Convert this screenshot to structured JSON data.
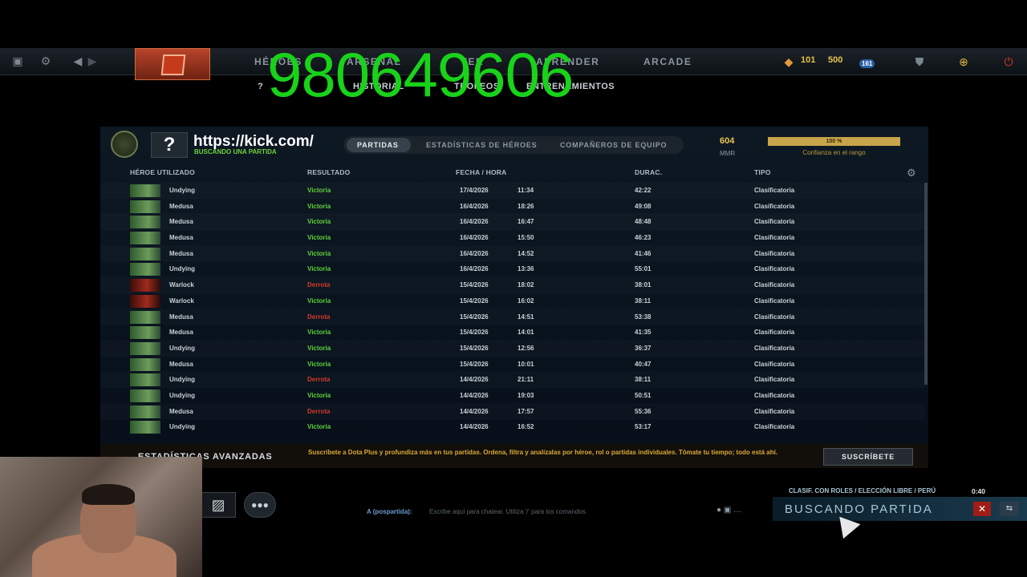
{
  "topbar": {
    "icons": [
      "screenshot-icon",
      "gear-icon",
      "back-icon",
      "forward-icon"
    ],
    "nav": [
      "HÉROES",
      "ARSENAL",
      "VER",
      "APRENDER",
      "ARCADE"
    ],
    "shards": "101",
    "tokens": "500",
    "level": "161"
  },
  "subnav": {
    "help": "?",
    "history": "HISTORIAL",
    "trophies": "TROFEOS",
    "training": "ENTRENAMIENTOS"
  },
  "overlay": {
    "phone": "980649606"
  },
  "profile": {
    "placeholder": "?",
    "name": "https://kick.com/",
    "status": "BUSCANDO UNA PARTIDA",
    "tabs": [
      "PARTIDAS",
      "ESTADÍSTICAS DE HÉROES",
      "COMPAÑEROS DE EQUIPO"
    ],
    "mmr_value": "604",
    "mmr_label": "MMR",
    "confidence_value": "100 %",
    "confidence_pct": 100,
    "confidence_label": "Confianza en el rango"
  },
  "table": {
    "headers": [
      "HÉROE UTILIZADO",
      "RESULTADO",
      "FECHA / HORA",
      "DURAC.",
      "TIPO"
    ],
    "rows": [
      {
        "hero": "Undying",
        "result": "Victoria",
        "date": "17/4/2026",
        "time": "11:34",
        "duration": "42:22",
        "type": "Clasificatoria",
        "win": true,
        "portrait": "green"
      },
      {
        "hero": "Medusa",
        "result": "Victoria",
        "date": "16/4/2026",
        "time": "18:26",
        "duration": "49:08",
        "type": "Clasificatoria",
        "win": true,
        "portrait": "green"
      },
      {
        "hero": "Medusa",
        "result": "Victoria",
        "date": "16/4/2026",
        "time": "16:47",
        "duration": "48:48",
        "type": "Clasificatoria",
        "win": true,
        "portrait": "green"
      },
      {
        "hero": "Medusa",
        "result": "Victoria",
        "date": "16/4/2026",
        "time": "15:50",
        "duration": "46:23",
        "type": "Clasificatoria",
        "win": true,
        "portrait": "green"
      },
      {
        "hero": "Medusa",
        "result": "Victoria",
        "date": "16/4/2026",
        "time": "14:52",
        "duration": "41:46",
        "type": "Clasificatoria",
        "win": true,
        "portrait": "green"
      },
      {
        "hero": "Undying",
        "result": "Victoria",
        "date": "16/4/2026",
        "time": "13:36",
        "duration": "55:01",
        "type": "Clasificatoria",
        "win": true,
        "portrait": "green"
      },
      {
        "hero": "Warlock",
        "result": "Derrota",
        "date": "15/4/2026",
        "time": "18:02",
        "duration": "38:01",
        "type": "Clasificatoria",
        "win": false,
        "portrait": "red"
      },
      {
        "hero": "Warlock",
        "result": "Victoria",
        "date": "15/4/2026",
        "time": "16:02",
        "duration": "38:11",
        "type": "Clasificatoria",
        "win": true,
        "portrait": "red"
      },
      {
        "hero": "Medusa",
        "result": "Derrota",
        "date": "15/4/2026",
        "time": "14:51",
        "duration": "53:38",
        "type": "Clasificatoria",
        "win": false,
        "portrait": "green"
      },
      {
        "hero": "Medusa",
        "result": "Victoria",
        "date": "15/4/2026",
        "time": "14:01",
        "duration": "41:35",
        "type": "Clasificatoria",
        "win": true,
        "portrait": "green"
      },
      {
        "hero": "Undying",
        "result": "Victoria",
        "date": "15/4/2026",
        "time": "12:56",
        "duration": "36:37",
        "type": "Clasificatoria",
        "win": true,
        "portrait": "green"
      },
      {
        "hero": "Medusa",
        "result": "Victoria",
        "date": "15/4/2026",
        "time": "10:01",
        "duration": "40:47",
        "type": "Clasificatoria",
        "win": true,
        "portrait": "green"
      },
      {
        "hero": "Undying",
        "result": "Derrota",
        "date": "14/4/2026",
        "time": "21:11",
        "duration": "38:11",
        "type": "Clasificatoria",
        "win": false,
        "portrait": "green"
      },
      {
        "hero": "Undying",
        "result": "Victoria",
        "date": "14/4/2026",
        "time": "19:03",
        "duration": "50:51",
        "type": "Clasificatoria",
        "win": true,
        "portrait": "green"
      },
      {
        "hero": "Medusa",
        "result": "Derrota",
        "date": "14/4/2026",
        "time": "17:57",
        "duration": "55:36",
        "type": "Clasificatoria",
        "win": false,
        "portrait": "green"
      },
      {
        "hero": "Undying",
        "result": "Victoria",
        "date": "14/4/2026",
        "time": "16:52",
        "duration": "53:17",
        "type": "Clasificatoria",
        "win": true,
        "portrait": "green"
      }
    ]
  },
  "dotaplus": {
    "title": "ESTADÍSTICAS AVANZADAS",
    "text": "Suscríbete a Dota Plus y profundiza más en tus partidas. Ordena, filtra y analízalas por héroe, rol o partidas individuales. Tómate tu tiempo; todo está ahí.",
    "button": "SUSCRÍBETE"
  },
  "queue": {
    "info": "CLASIF. CON ROLES / ELECCIÓN LIBRE / PERÚ",
    "time": "0:40",
    "label": "BUSCANDO PARTIDA"
  },
  "chat": {
    "label": "A (pospartida):",
    "placeholder": "Escribe aquí para chatear. Utiliza '/' para los comandos."
  }
}
